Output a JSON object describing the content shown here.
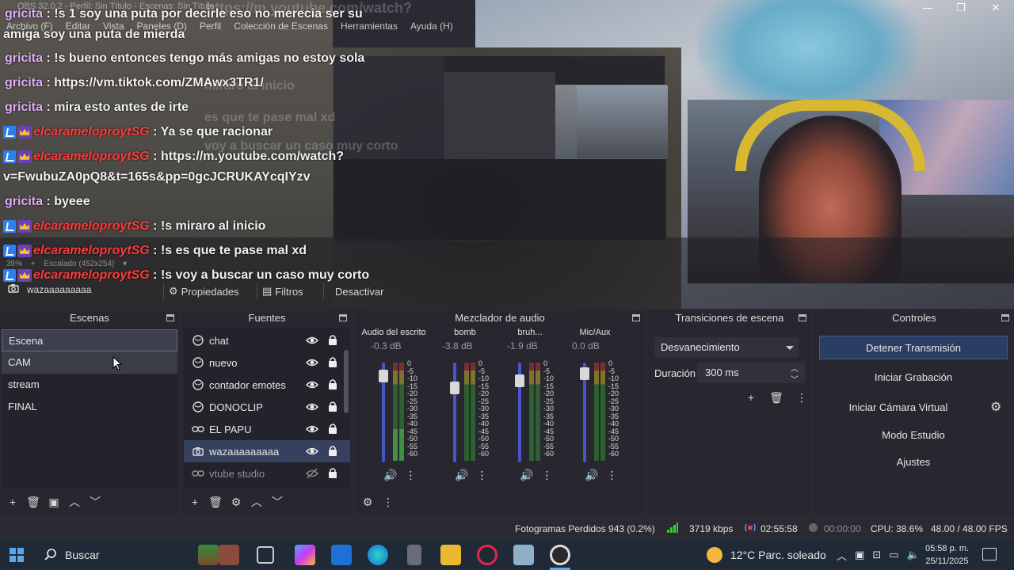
{
  "window": {
    "title": "OBS 32.0.2 - Perfil: Sin Título - Escenas: Sin Título",
    "minimize": "—",
    "maximize": "❐",
    "close": "✕"
  },
  "menu": [
    "Archivo (F)",
    "Editar",
    "Vista",
    "Paneles (D)",
    "Perfil",
    "Colección de Escenas",
    "Herramientas",
    "Ayuda (H)"
  ],
  "chat": {
    "messages": [
      {
        "user": "gricita",
        "badges": false,
        "text": " : !s 1 soy una puta por decirle eso no merecia ser su"
      },
      {
        "user": "",
        "badges": false,
        "text": "amiga soy una puta de mierda"
      },
      {
        "user": "gricita",
        "badges": false,
        "text": " : !s bueno entonces tengo más amigas no estoy sola"
      },
      {
        "user": "gricita",
        "badges": false,
        "text": " : https://vm.tiktok.com/ZMAwx3TR1/"
      },
      {
        "user": "gricita",
        "badges": false,
        "text": " : mira esto antes de irte"
      },
      {
        "user": "elcarameloproytSG",
        "badges": true,
        "text": " : Ya se que racionar"
      },
      {
        "user": "elcarameloproytSG",
        "badges": true,
        "text": " : https://m.youtube.com/watch?"
      },
      {
        "user": "",
        "badges": false,
        "text": "v=FwubuZA0pQ8&t=165s&pp=0gcJCRUKAYcqIYzv"
      },
      {
        "user": "gricita",
        "badges": false,
        "text": " : byeee"
      },
      {
        "user": "elcarameloproytSG",
        "badges": true,
        "text": " : !s miraro al inicio"
      },
      {
        "user": "elcarameloproytSG",
        "badges": true,
        "text": " : !s es que te pase mal xd"
      },
      {
        "user": "elcarameloproytSG",
        "badges": true,
        "text": " : !s voy a buscar un caso muy corto"
      }
    ],
    "ghosts": [
      "https://m.youtube.com/watch?",
      "miraro al inicio",
      "es que te pase mal xd",
      "voy a buscar un caso muy corto"
    ]
  },
  "preview": {
    "zoom": "35%",
    "scale": "Escalado (452x254)"
  },
  "source_toolbar": {
    "selected_source": "wazaaaaaaaaa",
    "properties": "Propiedades",
    "filters": "Filtros",
    "deactivate": "Desactivar"
  },
  "docks": {
    "scenes": {
      "title": "Escenas",
      "items": [
        "Escena",
        "CAM",
        "stream",
        "FINAL"
      ],
      "selected": "Escena"
    },
    "sources": {
      "title": "Fuentes",
      "items": [
        {
          "name": "chat",
          "icon": "browser-icon",
          "visible": true
        },
        {
          "name": "nuevo",
          "icon": "browser-icon",
          "visible": true
        },
        {
          "name": "contador emotes",
          "icon": "browser-icon",
          "visible": true
        },
        {
          "name": "DONOCLIP",
          "icon": "browser-icon",
          "visible": true
        },
        {
          "name": "EL PAPU",
          "icon": "link-icon",
          "visible": true
        },
        {
          "name": "wazaaaaaaaaa",
          "icon": "camera-icon",
          "visible": true
        },
        {
          "name": "vtube studio",
          "icon": "link-icon",
          "visible": false
        }
      ],
      "selected": "wazaaaaaaaaa"
    },
    "mixer": {
      "title": "Mezclador de audio",
      "channels": [
        {
          "name": "Audio del escrito",
          "db": "-0.3 dB",
          "fader": 0.92,
          "level": 0.32
        },
        {
          "name": "bomb",
          "db": "-3.8 dB",
          "fader": 0.78,
          "level": 0.0
        },
        {
          "name": "bruh...",
          "db": "-1.9 dB",
          "fader": 0.86,
          "level": 0.0
        },
        {
          "name": "Mic/Aux",
          "db": "0.0 dB",
          "fader": 0.95,
          "level": 0.0
        }
      ],
      "ticks": [
        "0",
        "-5",
        "-10",
        "-15",
        "-20",
        "-25",
        "-30",
        "-35",
        "-40",
        "-45",
        "-50",
        "-55",
        "-60"
      ]
    },
    "transitions": {
      "title": "Transiciones de escena",
      "selected": "Desvanecimiento",
      "duration_label": "Duración",
      "duration_value": "300 ms"
    },
    "controls": {
      "title": "Controles",
      "buttons": [
        "Detener Transmisión",
        "Iniciar Grabación",
        "Iniciar Cámara Virtual",
        "Modo Estudio",
        "Ajustes"
      ]
    }
  },
  "status": {
    "dropped": "Fotogramas Perdidos 943 (0.2%)",
    "bitrate": "3719 kbps",
    "stream_time": "02:55:58",
    "rec_time": "00:00:00",
    "cpu": "CPU: 38.6%",
    "fps": "48.00 / 48.00 FPS"
  },
  "taskbar": {
    "search": "Buscar",
    "weather": "12°C  Parc. soleado",
    "time": "05:58 p. m.",
    "date": "25/11/2025"
  }
}
